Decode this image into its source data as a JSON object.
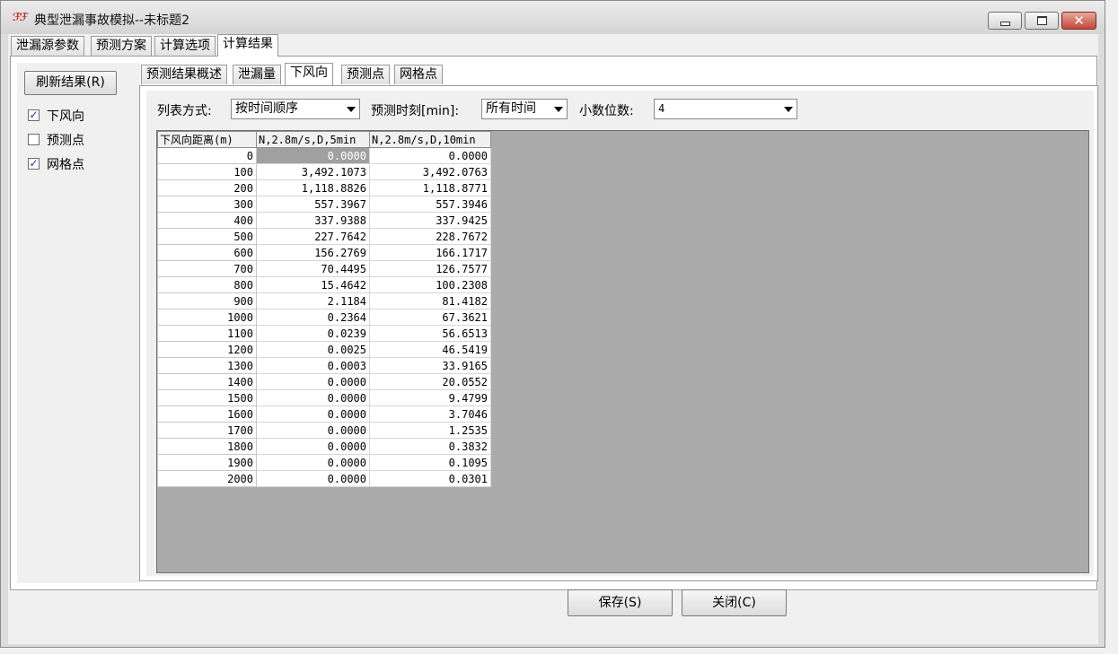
{
  "window": {
    "title": "典型泄漏事故模拟--未标题2",
    "icon": "app-logo-icon"
  },
  "main_tabs": [
    "泄漏源参数",
    "预测方案",
    "计算选项",
    "计算结果"
  ],
  "main_tabs_selected": "计算结果",
  "left_pane": {
    "refresh_label": "刷新结果(R)",
    "checkboxes": [
      {
        "label": "下风向",
        "checked": true
      },
      {
        "label": "预测点",
        "checked": false
      },
      {
        "label": "网格点",
        "checked": true
      }
    ]
  },
  "sub_tabs": [
    "预测结果概述",
    "泄漏量",
    "下风向",
    "预测点",
    "网格点"
  ],
  "sub_tabs_selected": "下风向",
  "options": {
    "list_mode_label": "列表方式:",
    "list_mode_value": "按时间顺序",
    "time_label": "预测时刻[min]:",
    "time_value": "所有时间",
    "decimals_label": "小数位数:",
    "decimals_value": "4"
  },
  "table": {
    "headers": [
      "下风向距离(m)",
      "N,2.8m/s,D,5min",
      "N,2.8m/s,D,10min"
    ],
    "rows": [
      [
        "0",
        "0.0000",
        "0.0000"
      ],
      [
        "100",
        "3,492.1073",
        "3,492.0763"
      ],
      [
        "200",
        "1,118.8826",
        "1,118.8771"
      ],
      [
        "300",
        "557.3967",
        "557.3946"
      ],
      [
        "400",
        "337.9388",
        "337.9425"
      ],
      [
        "500",
        "227.7642",
        "228.7672"
      ],
      [
        "600",
        "156.2769",
        "166.1717"
      ],
      [
        "700",
        "70.4495",
        "126.7577"
      ],
      [
        "800",
        "15.4642",
        "100.2308"
      ],
      [
        "900",
        "2.1184",
        "81.4182"
      ],
      [
        "1000",
        "0.2364",
        "67.3621"
      ],
      [
        "1100",
        "0.0239",
        "56.6513"
      ],
      [
        "1200",
        "0.0025",
        "46.5419"
      ],
      [
        "1300",
        "0.0003",
        "33.9165"
      ],
      [
        "1400",
        "0.0000",
        "20.0552"
      ],
      [
        "1500",
        "0.0000",
        "9.4799"
      ],
      [
        "1600",
        "0.0000",
        "3.7046"
      ],
      [
        "1700",
        "0.0000",
        "1.2535"
      ],
      [
        "1800",
        "0.0000",
        "0.3832"
      ],
      [
        "1900",
        "0.0000",
        "0.1095"
      ],
      [
        "2000",
        "0.0000",
        "0.0301"
      ]
    ]
  },
  "footer": {
    "save_label": "保存(S)",
    "close_label": "关闭(C)"
  },
  "colors": {
    "grid_background": "#ababab",
    "selected_cell": "#a0a0a0",
    "close_button": "#c4473a"
  }
}
